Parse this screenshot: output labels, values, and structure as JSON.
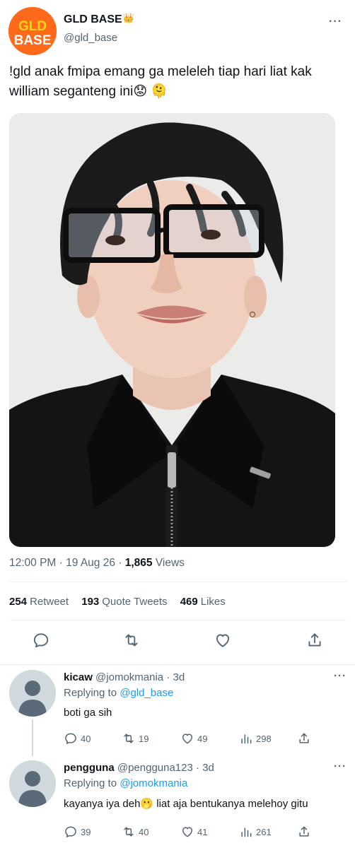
{
  "tweet": {
    "display_name": "GLD BASE",
    "badge_emoji": "👑",
    "handle": "@gld_base",
    "logo_text_top": "GLD",
    "logo_text_bottom": "BASE",
    "text_line1": "!gld anak fmipa emang ga meleleh tiap hari liat kak",
    "text_line2": "william seganteng ini😟 🫠",
    "time": "12:00 PM",
    "date": "19 Aug 26",
    "views_count": "1,865",
    "views_label": "Views",
    "retweets_count": "254",
    "retweets_label": "Retweet",
    "quotes_count": "193",
    "quotes_label": "Quote Tweets",
    "likes_count": "469",
    "likes_label": "Likes",
    "more_label": "···"
  },
  "replies": [
    {
      "name": "kicaw",
      "handle": "@jomokmania",
      "age": "3d",
      "replying_label": "Replying to",
      "replying_to": "@gld_base",
      "text": "boti ga sih",
      "replies": "40",
      "retweets": "19",
      "likes": "49",
      "views": "298"
    },
    {
      "name": "pengguna",
      "handle": "@pengguna123",
      "age": "3d",
      "replying_label": "Replying to",
      "replying_to": "@jomokmania",
      "text": "kayanya iya deh🫢  liat aja bentukanya melehoy gitu",
      "replies": "39",
      "retweets": "40",
      "likes": "41",
      "views": "261"
    }
  ],
  "colors": {
    "text": "#0f1419",
    "secondary": "#536471",
    "accent": "#1d9bf0",
    "brand_orange": "#ff6a1a",
    "brand_yellow": "#ffd21f"
  }
}
